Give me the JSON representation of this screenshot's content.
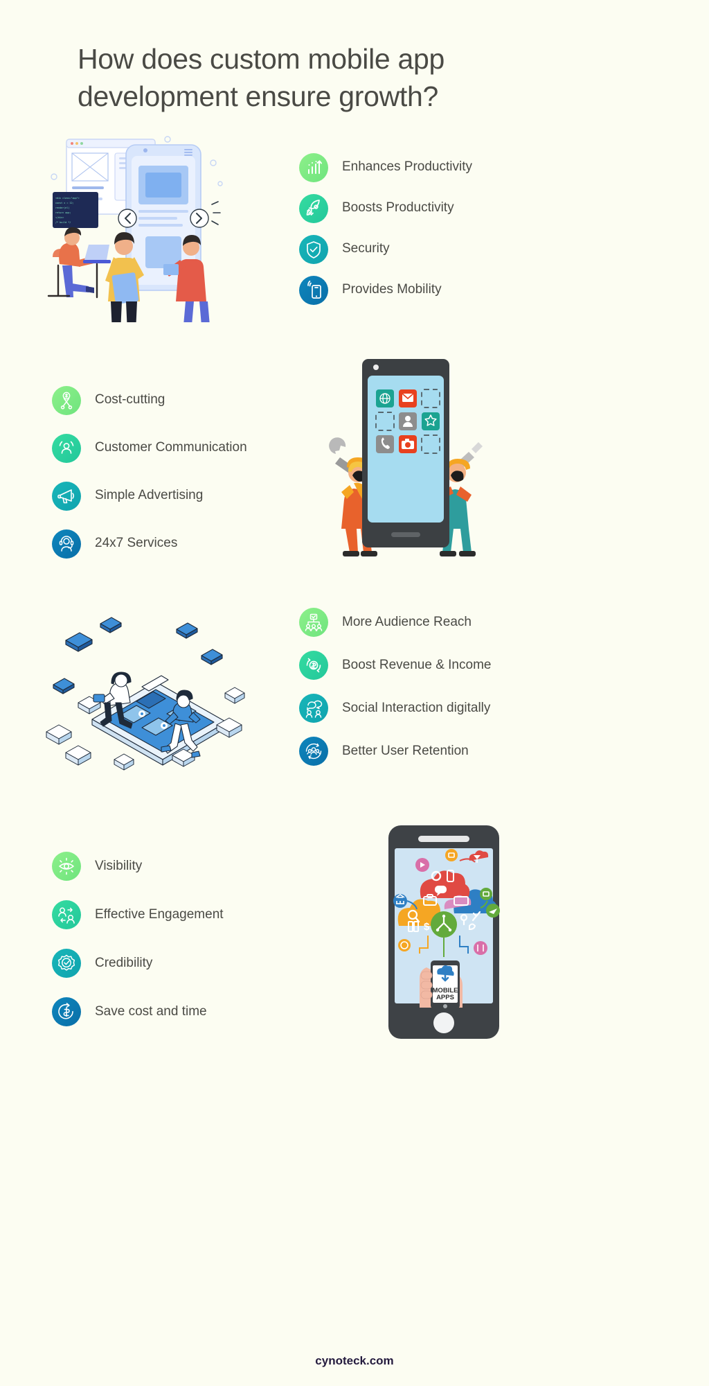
{
  "page": {
    "background_color": "#FCFDF2",
    "text_color": "#4A4A45",
    "title": "How does custom mobile app development ensure growth?"
  },
  "footer": {
    "brand": "cynoteck.com",
    "color": "#241B3E"
  },
  "palette": {
    "green_light": "#7BEA7E",
    "green_mint": "#2ED39C",
    "teal": "#12A8B4",
    "blue": "#0E7FB8",
    "title_gray": "#4A4A45"
  },
  "lists": [
    {
      "id": "list-top",
      "position": "top-right",
      "items": [
        {
          "label": "Enhances Productivity",
          "icon": "bar-chart-growth-icon",
          "color_start": "#8DF08A",
          "color_end": "#6FE47E"
        },
        {
          "label": "Boosts Productivity",
          "icon": "rocket-icon",
          "color_start": "#35DCA0",
          "color_end": "#23C79B"
        },
        {
          "label": "Security",
          "icon": "shield-check-icon",
          "color_start": "#18B6B8",
          "color_end": "#10A3AE"
        },
        {
          "label": "Provides Mobility",
          "icon": "mobile-signal-icon",
          "color_start": "#0E86BC",
          "color_end": "#0A6FA8"
        }
      ]
    },
    {
      "id": "list-second",
      "position": "mid-left",
      "items": [
        {
          "label": "Cost-cutting",
          "icon": "scissors-money-icon",
          "color_start": "#8DF08A",
          "color_end": "#6FE47E"
        },
        {
          "label": "Customer Communication",
          "icon": "customer-person-icon",
          "color_start": "#35DCA0",
          "color_end": "#23C79B"
        },
        {
          "label": "Simple Advertising",
          "icon": "megaphone-icon",
          "color_start": "#18B6B8",
          "color_end": "#10A3AE"
        },
        {
          "label": "24x7 Services",
          "icon": "headset-support-icon",
          "color_start": "#0E86BC",
          "color_end": "#0A6FA8"
        }
      ]
    },
    {
      "id": "list-third",
      "position": "mid-right",
      "items": [
        {
          "label": "More Audience Reach",
          "icon": "audience-network-icon",
          "color_start": "#8DF08A",
          "color_end": "#6FE47E"
        },
        {
          "label": "Boost Revenue & Income",
          "icon": "dollar-refresh-icon",
          "color_start": "#35DCA0",
          "color_end": "#23C79B"
        },
        {
          "label": "Social Interaction digitally",
          "icon": "social-chat-icon",
          "color_start": "#18B6B8",
          "color_end": "#10A3AE"
        },
        {
          "label": "Better User Retention",
          "icon": "user-retention-icon",
          "color_start": "#0E86BC",
          "color_end": "#0A6FA8"
        }
      ]
    },
    {
      "id": "list-fourth",
      "position": "bottom-left",
      "items": [
        {
          "label": "Visibility",
          "icon": "eye-visibility-icon",
          "color_start": "#8DF08A",
          "color_end": "#6FE47E"
        },
        {
          "label": "Effective Engagement",
          "icon": "engagement-users-icon",
          "color_start": "#35DCA0",
          "color_end": "#23C79B"
        },
        {
          "label": "Credibility",
          "icon": "badge-check-icon",
          "color_start": "#18B6B8",
          "color_end": "#10A3AE"
        },
        {
          "label": "Save cost and time",
          "icon": "dollar-clock-icon",
          "color_start": "#0E86BC",
          "color_end": "#0A6FA8"
        }
      ]
    }
  ],
  "illustrations": {
    "team_app_screens": {
      "name": "team-working-on-app-screens",
      "description": "Three people around a large phone mockup and wireframe browser windows"
    },
    "phone_app_grid": {
      "name": "phone-app-grid-with-workers",
      "description": "Dark phone showing 3x3 app grid, two construction workers with wrench and screwdriver",
      "apps": [
        {
          "name": "globe-icon",
          "color": "#1BA391",
          "placeholder": false
        },
        {
          "name": "mail-icon",
          "color": "#E8411F",
          "placeholder": false
        },
        {
          "name": "placeholder",
          "color": "",
          "placeholder": true
        },
        {
          "name": "placeholder",
          "color": "",
          "placeholder": true
        },
        {
          "name": "contact-icon",
          "color": "#8D8D8D",
          "placeholder": false
        },
        {
          "name": "star-icon",
          "color": "#1BA391",
          "placeholder": false
        },
        {
          "name": "phone-icon",
          "color": "#8D8D8D",
          "placeholder": false
        },
        {
          "name": "camera-icon",
          "color": "#E8411F",
          "placeholder": false
        },
        {
          "name": "placeholder",
          "color": "",
          "placeholder": true
        }
      ]
    },
    "isometric_dev": {
      "name": "isometric-mobile-development",
      "description": "Isometric blue phone platform with two people and floating boxes and chat bubbles"
    },
    "big_phone_cloud": {
      "name": "phone-with-cloud-apps",
      "screen_caption_line1": "MOBILE",
      "screen_caption_line2": "APPS",
      "description": "Large dark phone whose screen shows colorful clouds of app icons above a hand holding a phone"
    }
  }
}
